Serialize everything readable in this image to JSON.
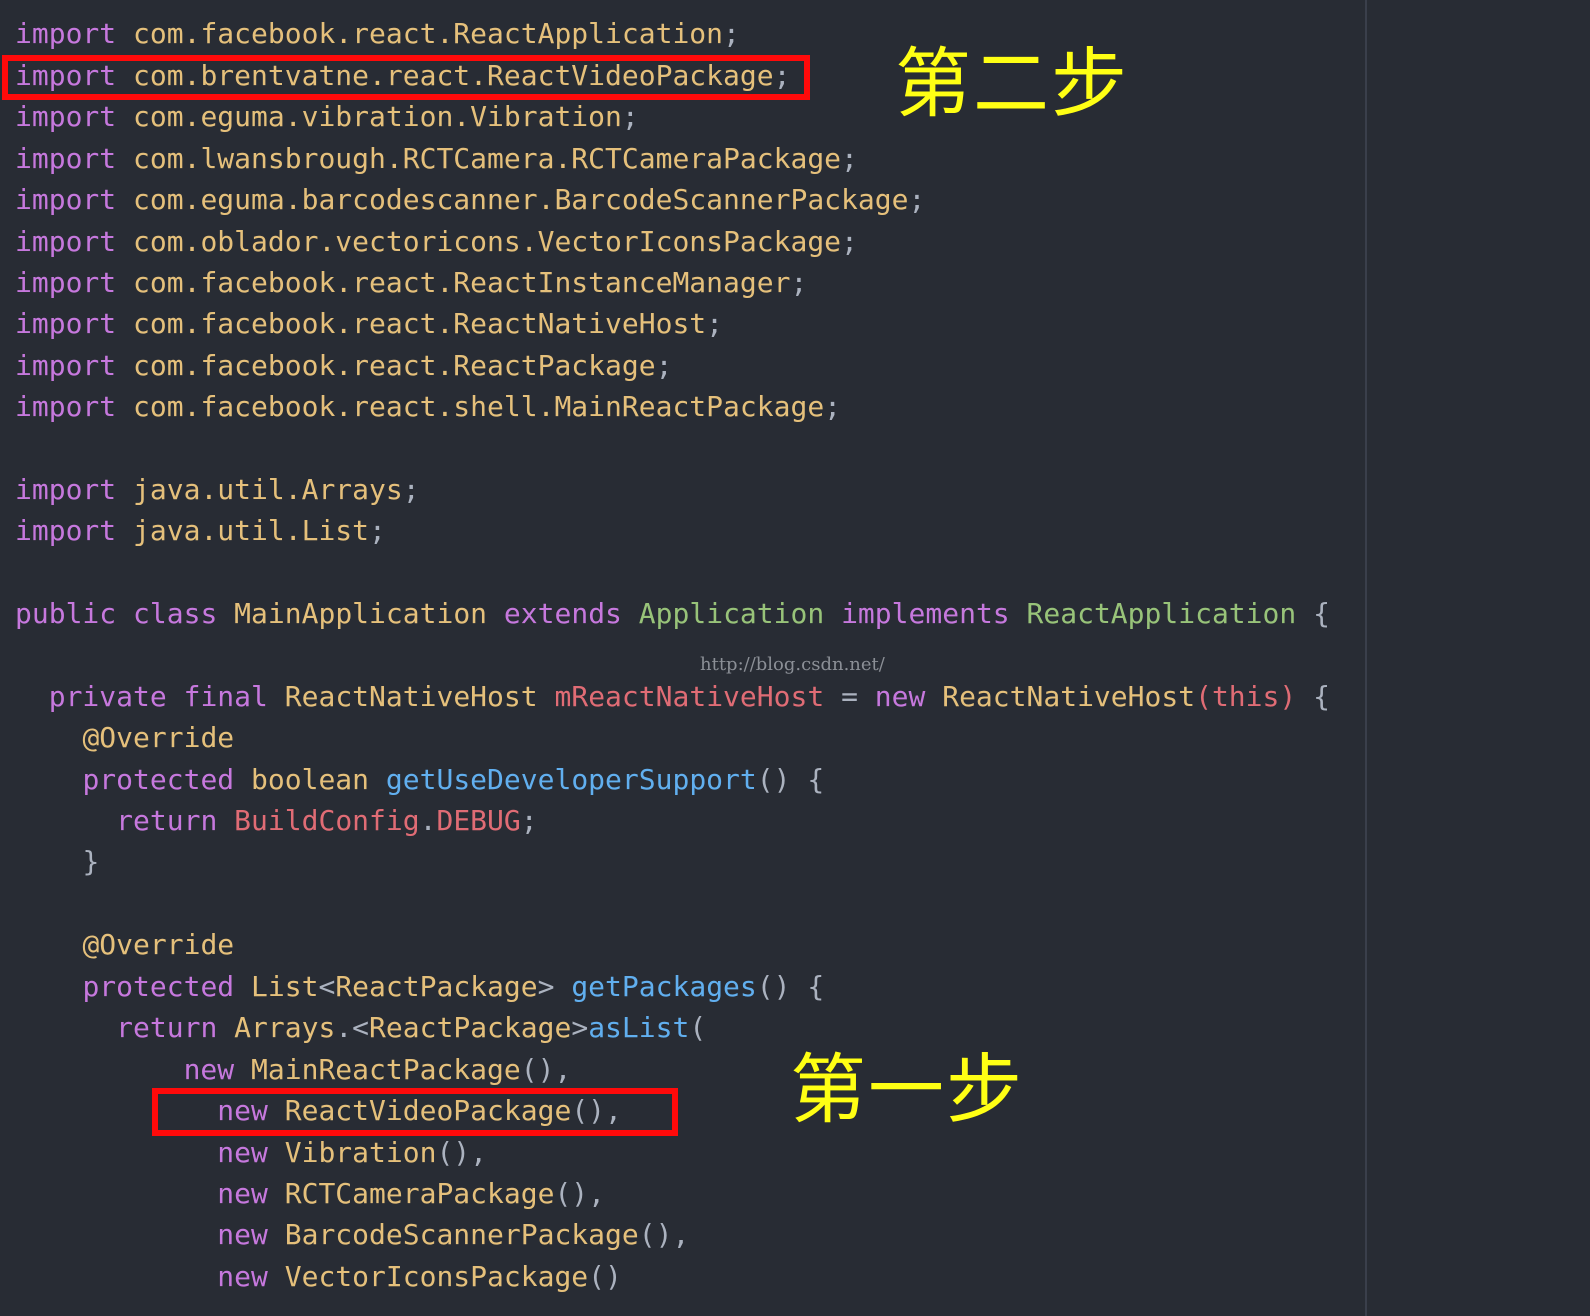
{
  "code": {
    "imports": [
      {
        "keyword": "import",
        "path": "com.facebook.react.ReactApplication",
        "end": ";"
      },
      {
        "keyword": "import",
        "path": "com.brentvatne.react.ReactVideoPackage",
        "end": ";"
      },
      {
        "keyword": "import",
        "path": "com.eguma.vibration.Vibration",
        "end": ";"
      },
      {
        "keyword": "import",
        "path": "com.lwansbrough.RCTCamera.RCTCameraPackage",
        "end": ";"
      },
      {
        "keyword": "import",
        "path": "com.eguma.barcodescanner.BarcodeScannerPackage",
        "end": ";"
      },
      {
        "keyword": "import",
        "path": "com.oblador.vectoricons.VectorIconsPackage",
        "end": ";"
      },
      {
        "keyword": "import",
        "path": "com.facebook.react.ReactInstanceManager",
        "end": ";"
      },
      {
        "keyword": "import",
        "path": "com.facebook.react.ReactNativeHost",
        "end": ";"
      },
      {
        "keyword": "import",
        "path": "com.facebook.react.ReactPackage",
        "end": ";"
      },
      {
        "keyword": "import",
        "path": "com.facebook.react.shell.MainReactPackage",
        "end": ";"
      }
    ],
    "java_imports": [
      {
        "keyword": "import",
        "path": "java.util.Arrays",
        "end": ";"
      },
      {
        "keyword": "import",
        "path": "java.util.List",
        "end": ";"
      }
    ],
    "class_decl": {
      "kw_public": "public",
      "kw_class": "class",
      "name": "MainApplication",
      "kw_extends": "extends",
      "parent": "Application",
      "kw_implements": "implements",
      "iface": "ReactApplication",
      "brace": "{"
    },
    "field_decl": {
      "kw_private": "private",
      "kw_final": "final",
      "type": "ReactNativeHost",
      "name": "mReactNativeHost",
      "eq": "=",
      "kw_new": "new",
      "ctor": "ReactNativeHost",
      "args": "(this)",
      "brace": "{"
    },
    "override_1": "@Override",
    "method_1": {
      "kw_protected": "protected",
      "ret": "boolean",
      "name": "getUseDeveloperSupport",
      "sig": "() {"
    },
    "return_1": {
      "kw_return": "return",
      "cls": "BuildConfig",
      "dot": ".",
      "field": "DEBUG",
      "end": ";"
    },
    "close_1": "}",
    "override_2": "@Override",
    "method_2": {
      "kw_protected": "protected",
      "ret_a": "List",
      "lt": "<",
      "ret_b": "ReactPackage",
      "gt": ">",
      "name": "getPackages",
      "sig": "() {"
    },
    "return_2": {
      "kw_return": "return",
      "cls": "Arrays",
      "dot_lt": ".<",
      "generic": "ReactPackage",
      "gt": ">",
      "call": "asList",
      "paren": "("
    },
    "packages": [
      {
        "kw_new": "new",
        "name": "MainReactPackage",
        "tail": "(),"
      },
      {
        "kw_new": "new",
        "name": "ReactVideoPackage",
        "tail": "(),"
      },
      {
        "kw_new": "new",
        "name": "Vibration",
        "tail": "(),"
      },
      {
        "kw_new": "new",
        "name": "RCTCameraPackage",
        "tail": "(),"
      },
      {
        "kw_new": "new",
        "name": "BarcodeScannerPackage",
        "tail": "(),"
      },
      {
        "kw_new": "new",
        "name": "VectorIconsPackage",
        "tail": "()"
      }
    ]
  },
  "annotations": {
    "step_two": "第二步",
    "step_one": "第一步"
  },
  "watermark": "http://blog.csdn.net/",
  "colors": {
    "background": "#282c34",
    "keyword": "#c678dd",
    "type": "#e5c07b",
    "inherit": "#98c379",
    "field": "#e06c75",
    "function": "#61afef",
    "highlight_box": "#ff0a0a",
    "step_label": "#ffff14"
  }
}
